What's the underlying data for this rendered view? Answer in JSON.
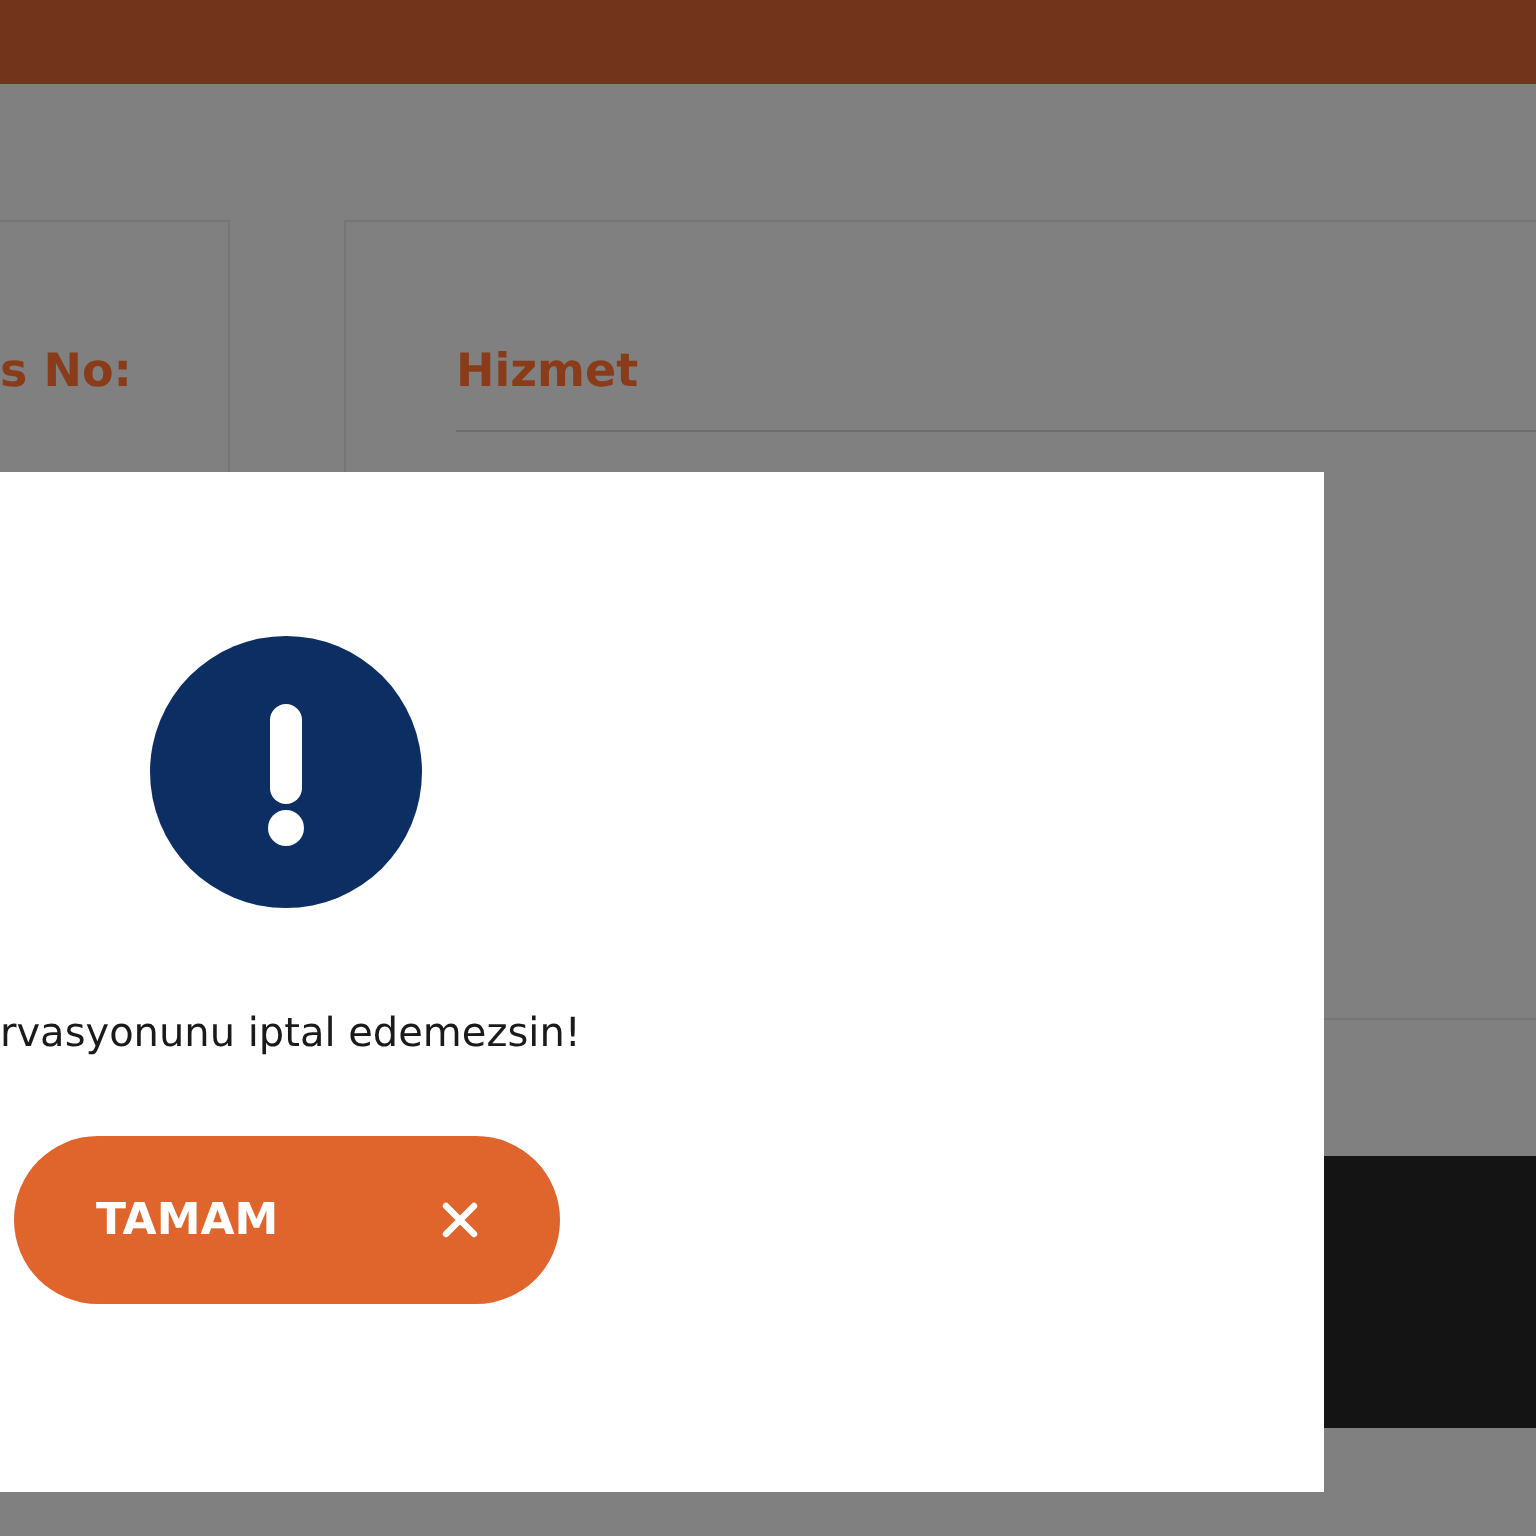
{
  "cards": [
    {
      "label": "s No:"
    },
    {
      "label": "Hizmet"
    }
  ],
  "dialog": {
    "message": "rvasyonunu iptal edemezsin!",
    "button": {
      "label": "TAMAM"
    }
  }
}
